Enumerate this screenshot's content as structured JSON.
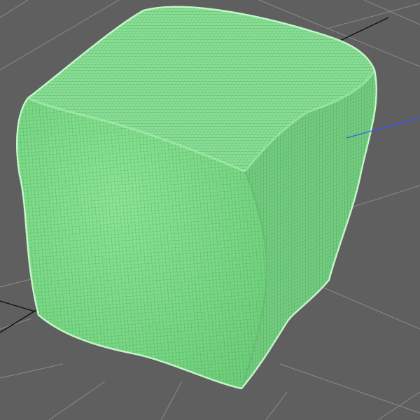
{
  "viewport": {
    "background_color": "#5f5f5f",
    "grid_line_color": "#8a8a8a",
    "grid_axis_color": "#111111",
    "z_axis_color": "#3355ff"
  },
  "mesh": {
    "object": "cube-mesh",
    "display_mode": "wireframe-on-shaded",
    "fill_color": "#7fdc8a",
    "wire_color": "#2e6a35",
    "highlight_color": "#b8f2bd"
  }
}
